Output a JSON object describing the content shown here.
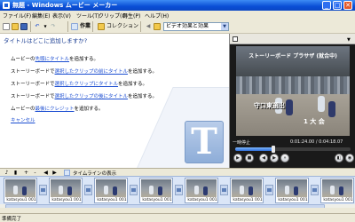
{
  "window": {
    "title": "無題 - Windows ムービー メーカー",
    "minimize": "_",
    "maximize": "□",
    "close": "✕"
  },
  "menu": [
    "ファイル(F)",
    "編集(E)",
    "表示(V)",
    "ツール(T)",
    "クリップ(C)",
    "再生(P)",
    "ヘルプ(H)"
  ],
  "toolbar": {
    "tasks_label": "作業",
    "collections_label": "コレクション",
    "collection_selected": "ビデオ効果と効果"
  },
  "task_pane": {
    "heading": "タイトルはどこに追加しますか?",
    "tasks": [
      {
        "pre": "ムービーの",
        "link": "先頭にタイトル",
        "post": "を追加する。"
      },
      {
        "pre": "ストーリーボードで",
        "link": "選択したクリップの前にタイトル",
        "post": "を追加する。"
      },
      {
        "pre": "ストーリーボードで",
        "link": "選択したクリップにタイトル",
        "post": "を追加する。"
      },
      {
        "pre": "ストーリーボードで",
        "link": "選択したクリップの後にタイトル",
        "post": "を追加する。"
      },
      {
        "pre": "ムービーの",
        "link": "最後にクレジット",
        "post": "を追加する。"
      }
    ],
    "cancel": "キャンセル"
  },
  "preview": {
    "caption": "ストーリーボード プラサザ (就合中)",
    "overlay_line1": "守口東選出",
    "overlay_line2": "1 大 会",
    "status": "一時停止",
    "time": "0:01:24.00 / 0:04:18.07",
    "progress_fraction": 0.33
  },
  "timeline_toolbar": {
    "show_timeline": "タイムラインの表示"
  },
  "storyboard": {
    "clips": [
      "katasyou1 001",
      "katasyou1 001",
      "katasyou1 001",
      "katasyou1 001",
      "katasyou1 001",
      "katasyou1 001",
      "katasyou1 001",
      "katasyou1 001"
    ]
  },
  "status_bar": {
    "text": "準備完了"
  },
  "colors": {
    "title_bar": "#0a4fd6",
    "task_heading": "#1c3f94",
    "link": "#1b4dd1",
    "storyboard_bg": "#dbe6f7"
  }
}
